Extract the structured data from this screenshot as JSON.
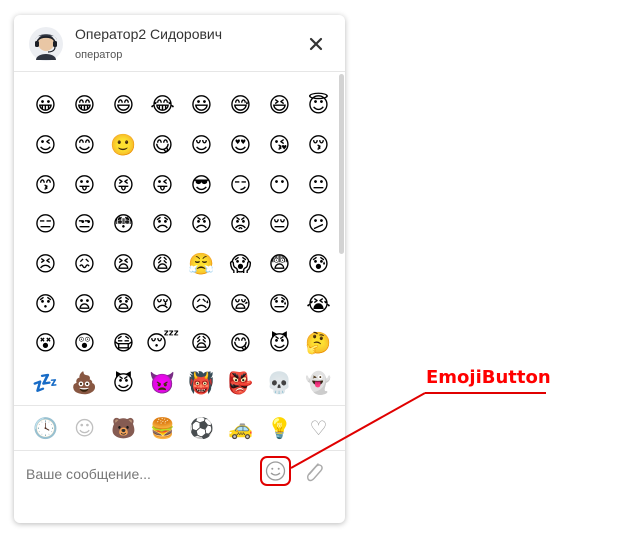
{
  "operator": {
    "name": "Оператор2 Сидорович",
    "role": "оператор",
    "avatar_icon": "operator-avatar-icon"
  },
  "header": {
    "close_icon": "close-icon"
  },
  "emojis": [
    "😀",
    "😁",
    "😄",
    "😂",
    "😃",
    "😅",
    "😆",
    "😇",
    "😉",
    "😊",
    "🙂",
    "😋",
    "😌",
    "😍",
    "😘",
    "😚",
    "😙",
    "😛",
    "😝",
    "😜",
    "😎",
    "😏",
    "😶",
    "😐",
    "😑",
    "😒",
    "😳",
    "😞",
    "😠",
    "😡",
    "😔",
    "😕",
    "😣",
    "😖",
    "😫",
    "😩",
    "😤",
    "😱",
    "😨",
    "😰",
    "😯",
    "😦",
    "😧",
    "😢",
    "😥",
    "😪",
    "😓",
    "😭",
    "😵",
    "😲",
    "😷",
    "😴",
    "😩",
    "😋",
    "😈",
    "🤔",
    "💤",
    "💩",
    "😈",
    "👿",
    "👹",
    "👺",
    "💀",
    "👻"
  ],
  "emoji_categories": [
    {
      "icon": "clock-icon",
      "glyph": "🕓"
    },
    {
      "icon": "smiley-icon",
      "glyph": "☺"
    },
    {
      "icon": "bear-icon",
      "glyph": "🐻"
    },
    {
      "icon": "food-icon",
      "glyph": "🍔"
    },
    {
      "icon": "ball-icon",
      "glyph": "⚽"
    },
    {
      "icon": "car-icon",
      "glyph": "🚕"
    },
    {
      "icon": "lightbulb-icon",
      "glyph": "💡"
    },
    {
      "icon": "heart-icon",
      "glyph": "♡"
    }
  ],
  "input": {
    "placeholder": "Ваше сообщение...",
    "value": ""
  },
  "annotation": {
    "label": "EmojiButton",
    "color": "#ff0000"
  },
  "colors": {
    "emoji_face": "#f9c21b",
    "emoji_outline": "#1e1e1e",
    "icon_gray": "#9a9a9a",
    "annotation_red": "#ff0000"
  }
}
